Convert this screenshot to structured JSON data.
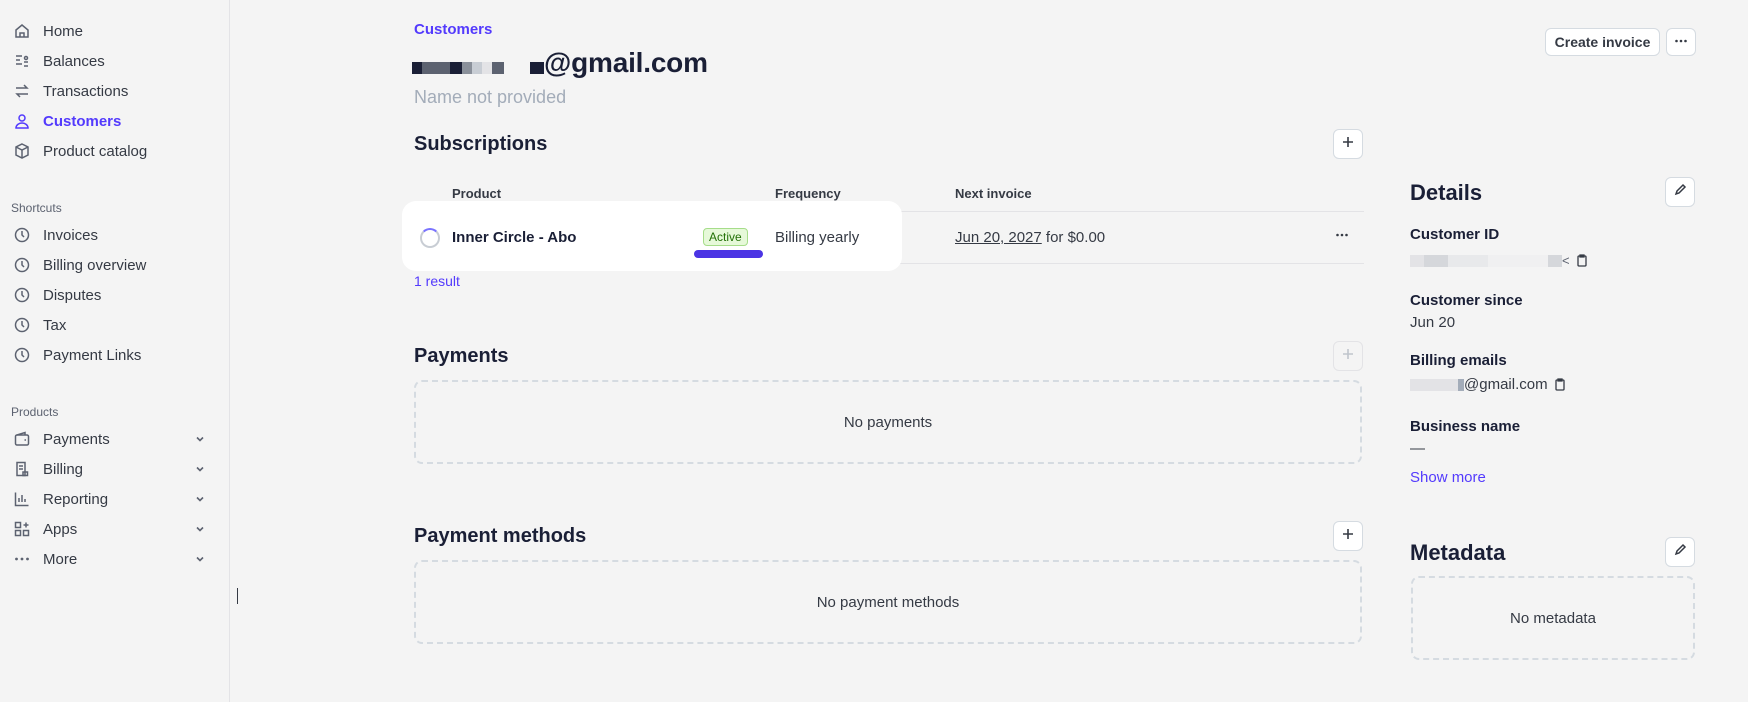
{
  "sidebar": {
    "main_items": [
      {
        "label": "Home",
        "icon": "home-icon"
      },
      {
        "label": "Balances",
        "icon": "balances-icon"
      },
      {
        "label": "Transactions",
        "icon": "transactions-icon"
      },
      {
        "label": "Customers",
        "icon": "user-icon",
        "active": true
      },
      {
        "label": "Product catalog",
        "icon": "box-icon"
      }
    ],
    "shortcuts_label": "Shortcuts",
    "shortcuts": [
      {
        "label": "Invoices"
      },
      {
        "label": "Billing overview"
      },
      {
        "label": "Disputes"
      },
      {
        "label": "Tax"
      },
      {
        "label": "Payment Links"
      }
    ],
    "products_label": "Products",
    "products": [
      {
        "label": "Payments"
      },
      {
        "label": "Billing"
      },
      {
        "label": "Reporting"
      },
      {
        "label": "Apps"
      },
      {
        "label": "More"
      }
    ]
  },
  "header": {
    "breadcrumb": "Customers",
    "email": "@gmail.com",
    "subtitle": "Name not provided",
    "create_invoice": "Create invoice",
    "more": "···"
  },
  "subscriptions": {
    "title": "Subscriptions",
    "columns": {
      "product": "Product",
      "frequency": "Frequency",
      "next_invoice": "Next invoice"
    },
    "row": {
      "product": "Inner Circle - Abo",
      "status": "Active",
      "frequency": "Billing yearly",
      "next_date": "Jun 20, 2027",
      "next_amount": " for $0.00"
    },
    "result_count": "1 result"
  },
  "payments": {
    "title": "Payments",
    "empty": "No payments"
  },
  "payment_methods": {
    "title": "Payment methods",
    "empty": "No payment methods"
  },
  "details": {
    "title": "Details",
    "customer_id_label": "Customer ID",
    "customer_id_suffix": "<",
    "customer_since_label": "Customer since",
    "customer_since": "Jun 20",
    "billing_emails_label": "Billing emails",
    "billing_email": "@gmail.com",
    "business_name_label": "Business name",
    "business_name": "—",
    "show_more": "Show more"
  },
  "metadata": {
    "title": "Metadata",
    "empty": "No metadata"
  },
  "colors": {
    "accent": "#533afd",
    "active_badge": "#e6f9d9",
    "marker": "#4b34e4"
  }
}
